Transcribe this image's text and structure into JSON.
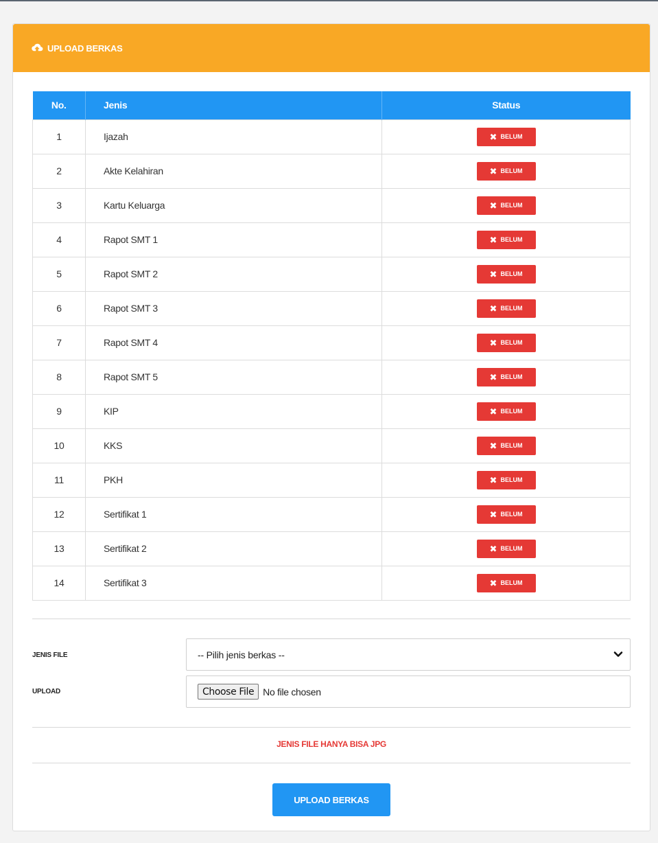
{
  "header": {
    "title": "UPLOAD BERKAS",
    "icon": "cloud-upload-icon",
    "color": "#f9a825"
  },
  "table": {
    "headers": {
      "no": "No.",
      "jenis": "Jenis",
      "status": "Status"
    },
    "rows": [
      {
        "no": "1",
        "jenis": "Ijazah",
        "status": "BELUM"
      },
      {
        "no": "2",
        "jenis": "Akte Kelahiran",
        "status": "BELUM"
      },
      {
        "no": "3",
        "jenis": "Kartu Keluarga",
        "status": "BELUM"
      },
      {
        "no": "4",
        "jenis": "Rapot SMT 1",
        "status": "BELUM"
      },
      {
        "no": "5",
        "jenis": "Rapot SMT 2",
        "status": "BELUM"
      },
      {
        "no": "6",
        "jenis": "Rapot SMT 3",
        "status": "BELUM"
      },
      {
        "no": "7",
        "jenis": "Rapot SMT 4",
        "status": "BELUM"
      },
      {
        "no": "8",
        "jenis": "Rapot SMT 5",
        "status": "BELUM"
      },
      {
        "no": "9",
        "jenis": "KIP",
        "status": "BELUM"
      },
      {
        "no": "10",
        "jenis": "KKS",
        "status": "BELUM"
      },
      {
        "no": "11",
        "jenis": "PKH",
        "status": "BELUM"
      },
      {
        "no": "12",
        "jenis": "Sertifikat 1",
        "status": "BELUM"
      },
      {
        "no": "13",
        "jenis": "Sertifikat 2",
        "status": "BELUM"
      },
      {
        "no": "14",
        "jenis": "Sertifikat 3",
        "status": "BELUM"
      }
    ],
    "status_icon": "x-mark-icon",
    "header_color": "#2196f3",
    "badge_color": "#e53935"
  },
  "form": {
    "jenis_file_label": "JENIS FILE",
    "jenis_file_value": "-- Pilih jenis berkas --",
    "upload_label": "UPLOAD",
    "choose_file_label": "Choose File",
    "file_status": "No file chosen"
  },
  "notice": {
    "text": "JENIS FILE HANYA BISA JPG",
    "color": "#e53935"
  },
  "submit": {
    "label": "UPLOAD BERKAS",
    "color": "#2196f3"
  }
}
